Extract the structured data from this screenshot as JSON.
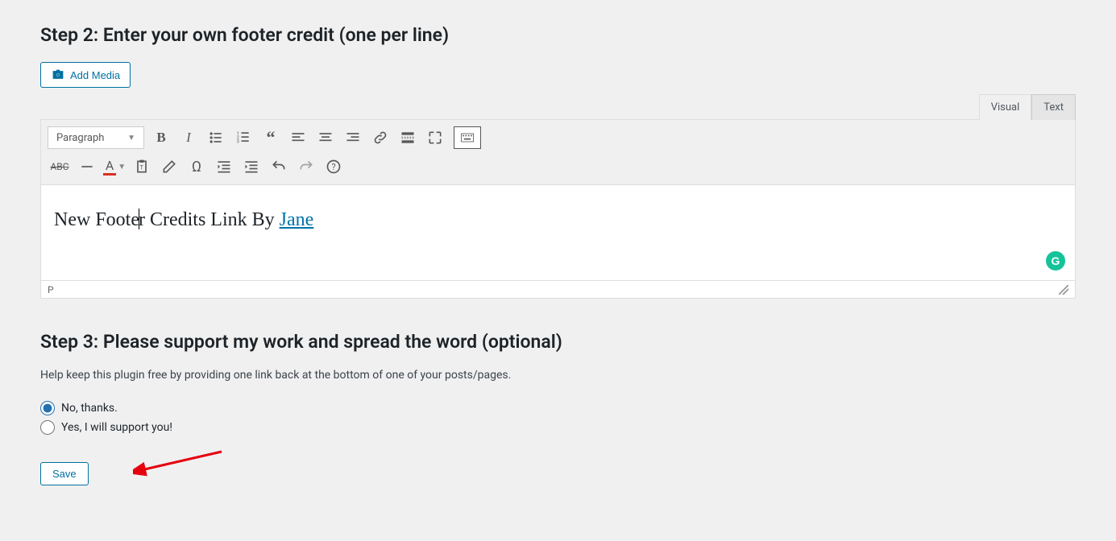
{
  "step2": {
    "heading": "Step 2: Enter your own footer credit (one per line)"
  },
  "addMedia": {
    "label": "Add Media"
  },
  "tabs": {
    "visual": "Visual",
    "text": "Text"
  },
  "format": {
    "selected": "Paragraph"
  },
  "editor": {
    "textPrefix": "New Foote",
    "textMiddle": "r Credits Link By ",
    "linkText": "Jane"
  },
  "statusBar": {
    "path": "P"
  },
  "step3": {
    "heading": "Step 3: Please support my work and spread the word (optional)",
    "help": "Help keep this plugin free by providing one link back at the bottom of one of your posts/pages.",
    "optionNo": "No, thanks.",
    "optionYes": "Yes, I will support you!"
  },
  "save": {
    "label": "Save"
  },
  "grammarly": {
    "letter": "G"
  },
  "colors": {
    "accent": "#0071a1",
    "textUnderline": "#d93025"
  }
}
